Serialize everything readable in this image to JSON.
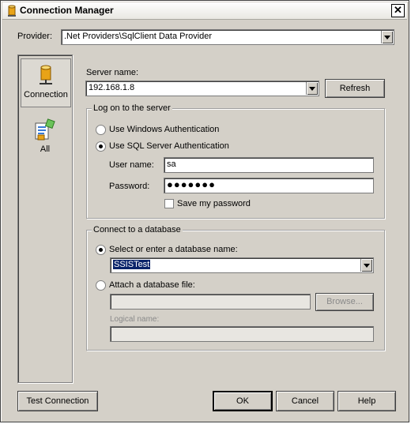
{
  "window": {
    "title": "Connection Manager"
  },
  "provider": {
    "label": "Provider:",
    "value": ".Net Providers\\SqlClient Data Provider"
  },
  "pages": [
    {
      "label": "Connection"
    },
    {
      "label": "All"
    }
  ],
  "server": {
    "label": "Server name:",
    "value": "192.168.1.8",
    "refresh_label": "Refresh"
  },
  "logon": {
    "title": "Log on to the server",
    "windows_auth": "Use Windows Authentication",
    "sql_auth": "Use SQL Server Authentication",
    "username_label": "User name:",
    "username_value": "sa",
    "password_label": "Password:",
    "password_value": "●●●●●●●",
    "save_password": "Save my password"
  },
  "database": {
    "title": "Connect to a database",
    "select_label": "Select or enter a database name:",
    "select_value": "SSISTest",
    "attach_label": "Attach a database file:",
    "browse_label": "Browse...",
    "logical_label": "Logical name:"
  },
  "footer": {
    "test_label": "Test Connection",
    "ok_label": "OK",
    "cancel_label": "Cancel",
    "help_label": "Help"
  }
}
